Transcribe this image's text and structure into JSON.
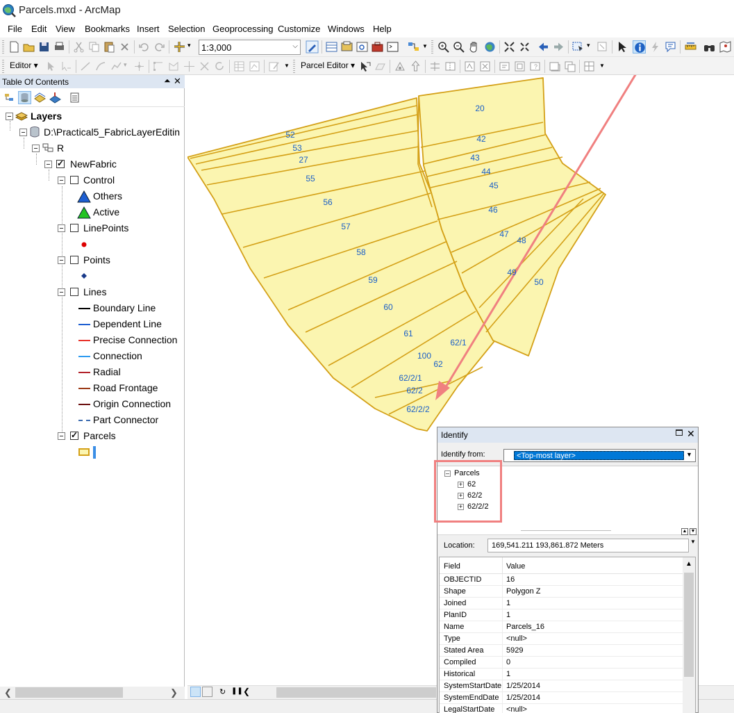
{
  "window": {
    "title": "Parcels.mxd - ArcMap"
  },
  "menu": [
    "File",
    "Edit",
    "View",
    "Bookmarks",
    "Insert",
    "Selection",
    "Geoprocessing",
    "Customize",
    "Windows",
    "Help"
  ],
  "toolbar": {
    "scale": "1:3,000",
    "editor_label": "Editor ▾",
    "parcel_editor_label": "Parcel Editor ▾"
  },
  "toc": {
    "header": "Table Of Contents",
    "pin_icon": "\u0018",
    "close_icon": "✕",
    "items": {
      "layers": "Layers",
      "db": "D:\\Practical5_FabricLayerEditin",
      "r": "R",
      "fabric": "NewFabric",
      "control": "Control",
      "others": "Others",
      "active": "Active",
      "linepoints": "LinePoints",
      "points": "Points",
      "lines": "Lines",
      "boundary": "Boundary Line",
      "dependent": "Dependent Line",
      "precise": "Precise Connection",
      "connection": "Connection",
      "radial": "Radial",
      "road": "Road Frontage",
      "origin": "Origin Connection",
      "part": "Part Connector",
      "parcels": "Parcels"
    }
  },
  "map": {
    "labels": [
      "20",
      "52",
      "53",
      "27",
      "42",
      "43",
      "44",
      "45",
      "55",
      "56",
      "46",
      "57",
      "47",
      "48",
      "58",
      "49",
      "50",
      "59",
      "60",
      "61",
      "62/1",
      "100",
      "62",
      "62/2/1",
      "62/2",
      "62/2/2"
    ]
  },
  "identify": {
    "title": "Identify",
    "from_label": "Identify from:",
    "from_value": "<Top-most layer>",
    "tree_root": "Parcels",
    "tree_items": [
      "62",
      "62/2",
      "62/2/2"
    ],
    "location_label": "Location:",
    "location_value": "169,541.211  193,861.872 Meters",
    "col_field": "Field",
    "col_value": "Value",
    "rows": [
      {
        "field": "OBJECTID",
        "value": "16"
      },
      {
        "field": "Shape",
        "value": "Polygon Z"
      },
      {
        "field": "Joined",
        "value": "1"
      },
      {
        "field": "PlanID",
        "value": "1"
      },
      {
        "field": "Name",
        "value": "Parcels_16"
      },
      {
        "field": "Type",
        "value": "<null>"
      },
      {
        "field": "Stated Area",
        "value": "5929"
      },
      {
        "field": "Compiled",
        "value": "0"
      },
      {
        "field": "Historical",
        "value": "1"
      },
      {
        "field": "SystemStartDate",
        "value": "1/25/2014"
      },
      {
        "field": "SystemEndDate",
        "value": "1/25/2014"
      },
      {
        "field": "LegalStartDate",
        "value": "<null>"
      }
    ]
  },
  "colors": {
    "parcel_fill": "#fbf5b0",
    "parcel_stroke": "#d4a017",
    "label": "#1a5fc8",
    "annotation_arrow": "#f08080",
    "highlight": "#f08080"
  }
}
